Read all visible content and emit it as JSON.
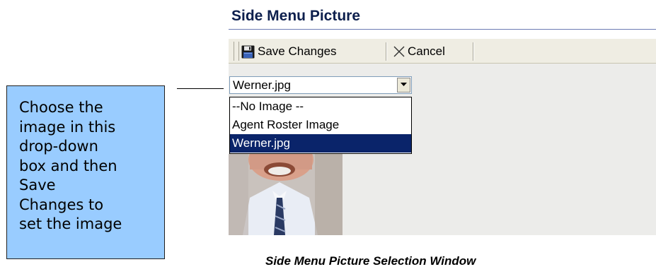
{
  "callout": {
    "lines": [
      "Choose the",
      "image in this",
      "drop-down",
      "box and then",
      "Save",
      "Changes to",
      "set the image"
    ]
  },
  "window": {
    "title": "Side Menu Picture",
    "toolbar": {
      "save_label": "Save Changes",
      "cancel_label": "Cancel",
      "save_icon": "floppy-disk-icon",
      "cancel_icon": "close-icon"
    },
    "select": {
      "value": "Werner.jpg",
      "options": [
        "--No Image --",
        "Agent Roster Image",
        "Werner.jpg"
      ],
      "selected_index": 2
    }
  },
  "caption": "Side Menu Picture Selection Window",
  "colors": {
    "callout_bg": "#99ccff",
    "title_text": "#0d1f4d",
    "selected_option_bg": "#0a246a",
    "toolbar_bg": "#efede3"
  }
}
